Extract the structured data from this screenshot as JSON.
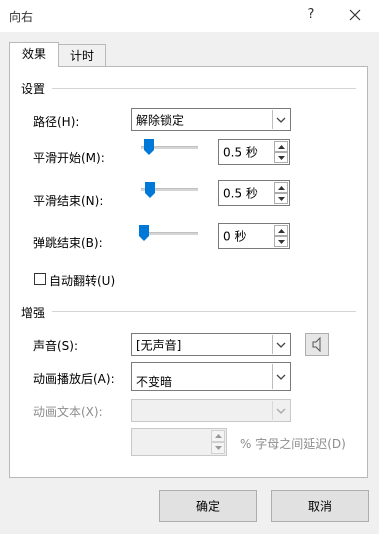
{
  "window": {
    "title": "向右",
    "help": "?"
  },
  "tabs": [
    {
      "label": "效果",
      "active": true
    },
    {
      "label": "计时",
      "active": false
    }
  ],
  "settings": {
    "group_label": "设置",
    "path": {
      "label": "路径(H):",
      "value": "解除锁定"
    },
    "smooth_start": {
      "label": "平滑开始(M):",
      "value": "0.5 秒"
    },
    "smooth_end": {
      "label": "平滑结束(N):",
      "value": "0.5 秒"
    },
    "bounce_end": {
      "label": "弹跳结束(B):",
      "value": "0 秒"
    },
    "auto_reverse": {
      "label": "自动翻转(U)",
      "checked": false
    }
  },
  "enhancements": {
    "group_label": "增强",
    "sound": {
      "label": "声音(S):",
      "value": "[无声音]"
    },
    "after_animation": {
      "label": "动画播放后(A):",
      "value": "不变暗"
    },
    "animate_text": {
      "label": "动画文本(X):",
      "value": ""
    },
    "delay": {
      "value": "",
      "suffix": "% 字母之间延迟(D)"
    }
  },
  "buttons": {
    "ok": "确定",
    "cancel": "取消"
  },
  "colors": {
    "accent": "#0078d7",
    "disabled_text": "#8d8d8d"
  }
}
